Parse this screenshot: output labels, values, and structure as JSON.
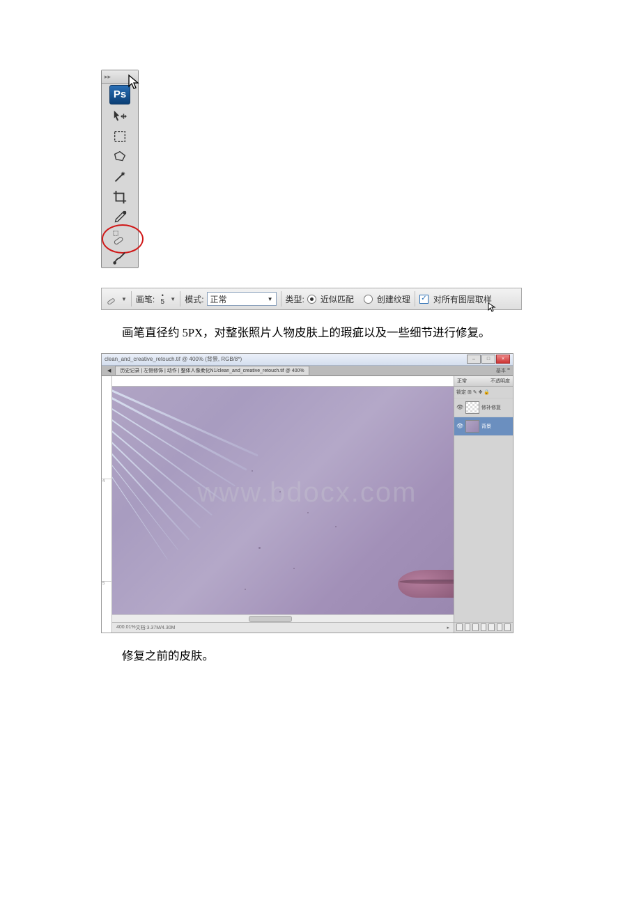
{
  "toolbox": {
    "app_badge": "Ps",
    "tools": [
      {
        "name": "move-tool"
      },
      {
        "name": "marquee-tool"
      },
      {
        "name": "lasso-tool"
      },
      {
        "name": "magic-wand-tool"
      },
      {
        "name": "crop-tool"
      },
      {
        "name": "eyedropper-tool"
      },
      {
        "name": "healing-brush-tool",
        "highlighted": true
      },
      {
        "name": "brush-tool"
      }
    ]
  },
  "options_bar": {
    "brush_label": "画笔:",
    "brush_size": "5",
    "mode_label": "模式:",
    "mode_value": "正常",
    "type_label": "类型:",
    "radio_proximity": "近似匹配",
    "radio_texture": "创建纹理",
    "checkbox_sample": "对所有图层取样"
  },
  "paragraph1": "画笔直径约 5PX，对整张照片人物皮肤上的瑕疵以及一些细节进行修复。",
  "ps_window": {
    "title": "clean_and_creative_retouch.tif @ 400% (背景, RGB/8*)",
    "tab_dropdown": "历史记录 | 左侧修饰 | 动作 | 整体人像柔化N1/clean_and_creative_retouch.tif @ 400%",
    "panels": {
      "layers_tab": "正常",
      "opacity_label": "不透明度",
      "lock_label": "锁定",
      "layer_group": "修补修复",
      "layer_bg": "背景"
    },
    "status_left": "400.01%",
    "status_doc": "文档:3.37M/4.30M",
    "watermark": "www.bdocx.com"
  },
  "paragraph2": "修复之前的皮肤。"
}
